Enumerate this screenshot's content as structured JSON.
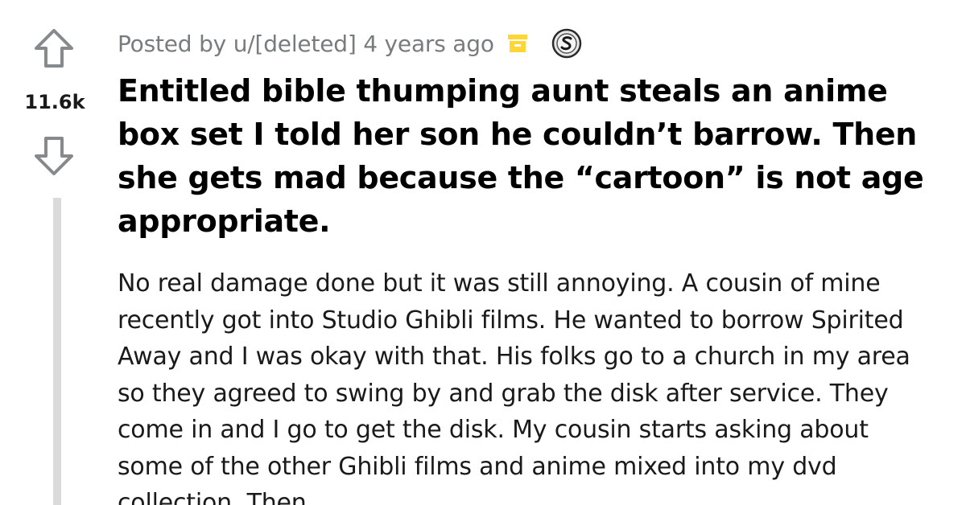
{
  "post": {
    "score": "11.6k",
    "meta": "Posted by u/[deleted] 4 years ago",
    "title": "Entitled bible thumping aunt steals an anime box set I told her son he couldn’t barrow. Then she gets mad because the “cartoon” is not age appropriate.",
    "body": "No real damage done but it was still annoying. A cousin of mine recently got into Studio Ghibli films. He wanted to borrow Spirited Away and I was okay with that. His folks go to a church in my area so they agreed to swing by and grab the disk after service. They come in and I go to get the disk. My cousin starts asking about some of the other Ghibli films and anime mixed into my dvd collection. Then",
    "icons": {
      "upvote": "upvote-arrow-icon",
      "downvote": "downvote-arrow-icon",
      "archive": "archive-box-icon",
      "award": "silver-award-icon"
    }
  },
  "colors": {
    "meta_text": "#787c7e",
    "archive_icon": "#ffd635",
    "arrow_outline": "#878a8c",
    "thread_line": "#dadada",
    "title": "#000000",
    "body": "#1a1a1b"
  }
}
